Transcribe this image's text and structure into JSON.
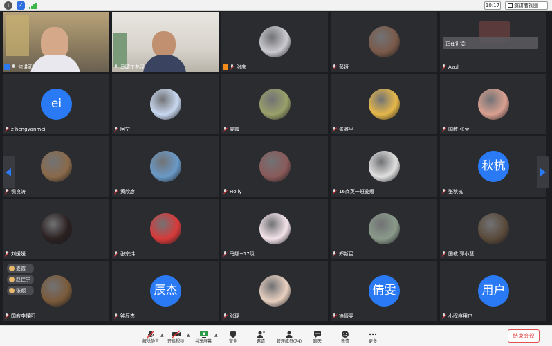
{
  "topbar": {
    "time": "10:17",
    "view_button": "演讲者视图"
  },
  "speaking": "正在讲话:",
  "participants": [
    {
      "name": "何讲武",
      "type": "video"
    },
    {
      "name": "马晴丁冬汉",
      "type": "video"
    },
    {
      "name": "张庆",
      "type": "photo",
      "color": "#c9c9cf"
    },
    {
      "name": "彭娅",
      "type": "photo",
      "color": "#7a5a4a"
    },
    {
      "name": "Azul",
      "type": "video"
    },
    {
      "name": "z hengyanmei",
      "type": "text",
      "initials": "ei"
    },
    {
      "name": "阿宁",
      "type": "photo",
      "color": "#c8d8f0"
    },
    {
      "name": "姜霞",
      "type": "photo",
      "color": "#9aa06a"
    },
    {
      "name": "张雅平",
      "type": "photo",
      "color": "#e6b84a"
    },
    {
      "name": "国教-张莹",
      "type": "photo",
      "color": "#d9a090"
    },
    {
      "name": "倪良涛",
      "type": "photo",
      "color": "#8a6a4a"
    },
    {
      "name": "黄欣彦",
      "type": "photo",
      "color": "#6a9ac8"
    },
    {
      "name": "Holly",
      "type": "photo",
      "color": "#8a5a5a"
    },
    {
      "name": "16商英一班姜烜",
      "type": "photo",
      "color": "#e0e0e0"
    },
    {
      "name": "张秋杭",
      "type": "text",
      "initials": "秋杭"
    },
    {
      "name": "刘媛媛",
      "type": "photo",
      "color": "#2a2020"
    },
    {
      "name": "张宗炜",
      "type": "photo",
      "color": "#d83a3a"
    },
    {
      "name": "马娜~17级",
      "type": "photo",
      "color": "#f4e4ea"
    },
    {
      "name": "郑新民",
      "type": "photo",
      "color": "#8a9a8a"
    },
    {
      "name": "国教 郭小慧",
      "type": "photo",
      "color": "#5a4a3a"
    },
    {
      "name": "国教李懂阳",
      "type": "photo",
      "color": "#7a5a3a"
    },
    {
      "name": "钟辰杰",
      "type": "text",
      "initials": "辰杰"
    },
    {
      "name": "张瑶",
      "type": "photo",
      "color": "#e8d0c0"
    },
    {
      "name": "徐倩雯",
      "type": "text",
      "initials": "倩雯"
    },
    {
      "name": "小程序用户",
      "type": "text",
      "initials": "用户"
    }
  ],
  "raised_hands": [
    "姜霞",
    "赵佳宁",
    "张穎"
  ],
  "toolbar": {
    "items": [
      "解除静音",
      "开启视频",
      "共享屏幕",
      "安全",
      "邀请",
      "管理成员(74)",
      "聊天",
      "表情",
      "更多"
    ],
    "end_button": "结束会议"
  },
  "colors": {
    "accent": "#2a7af5",
    "end": "#e03030"
  }
}
